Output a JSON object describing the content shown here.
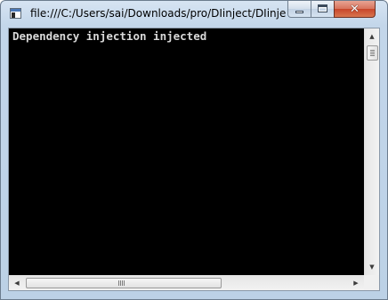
{
  "window": {
    "title": "file:///C:/Users/sai/Downloads/pro/DIinject/DIinject...",
    "icon": "console-app-icon"
  },
  "caption_buttons": {
    "minimize_icon": "minimize-icon",
    "maximize_icon": "maximize-icon",
    "close_icon": "close-icon",
    "close_glyph": "✕"
  },
  "console": {
    "lines": [
      "Dependency injection injected"
    ],
    "background": "#000000",
    "text_color": "#d8d8d8"
  },
  "scrollbars": {
    "up_arrow": "▲",
    "down_arrow": "▼",
    "left_arrow": "◀",
    "right_arrow": "▶"
  }
}
